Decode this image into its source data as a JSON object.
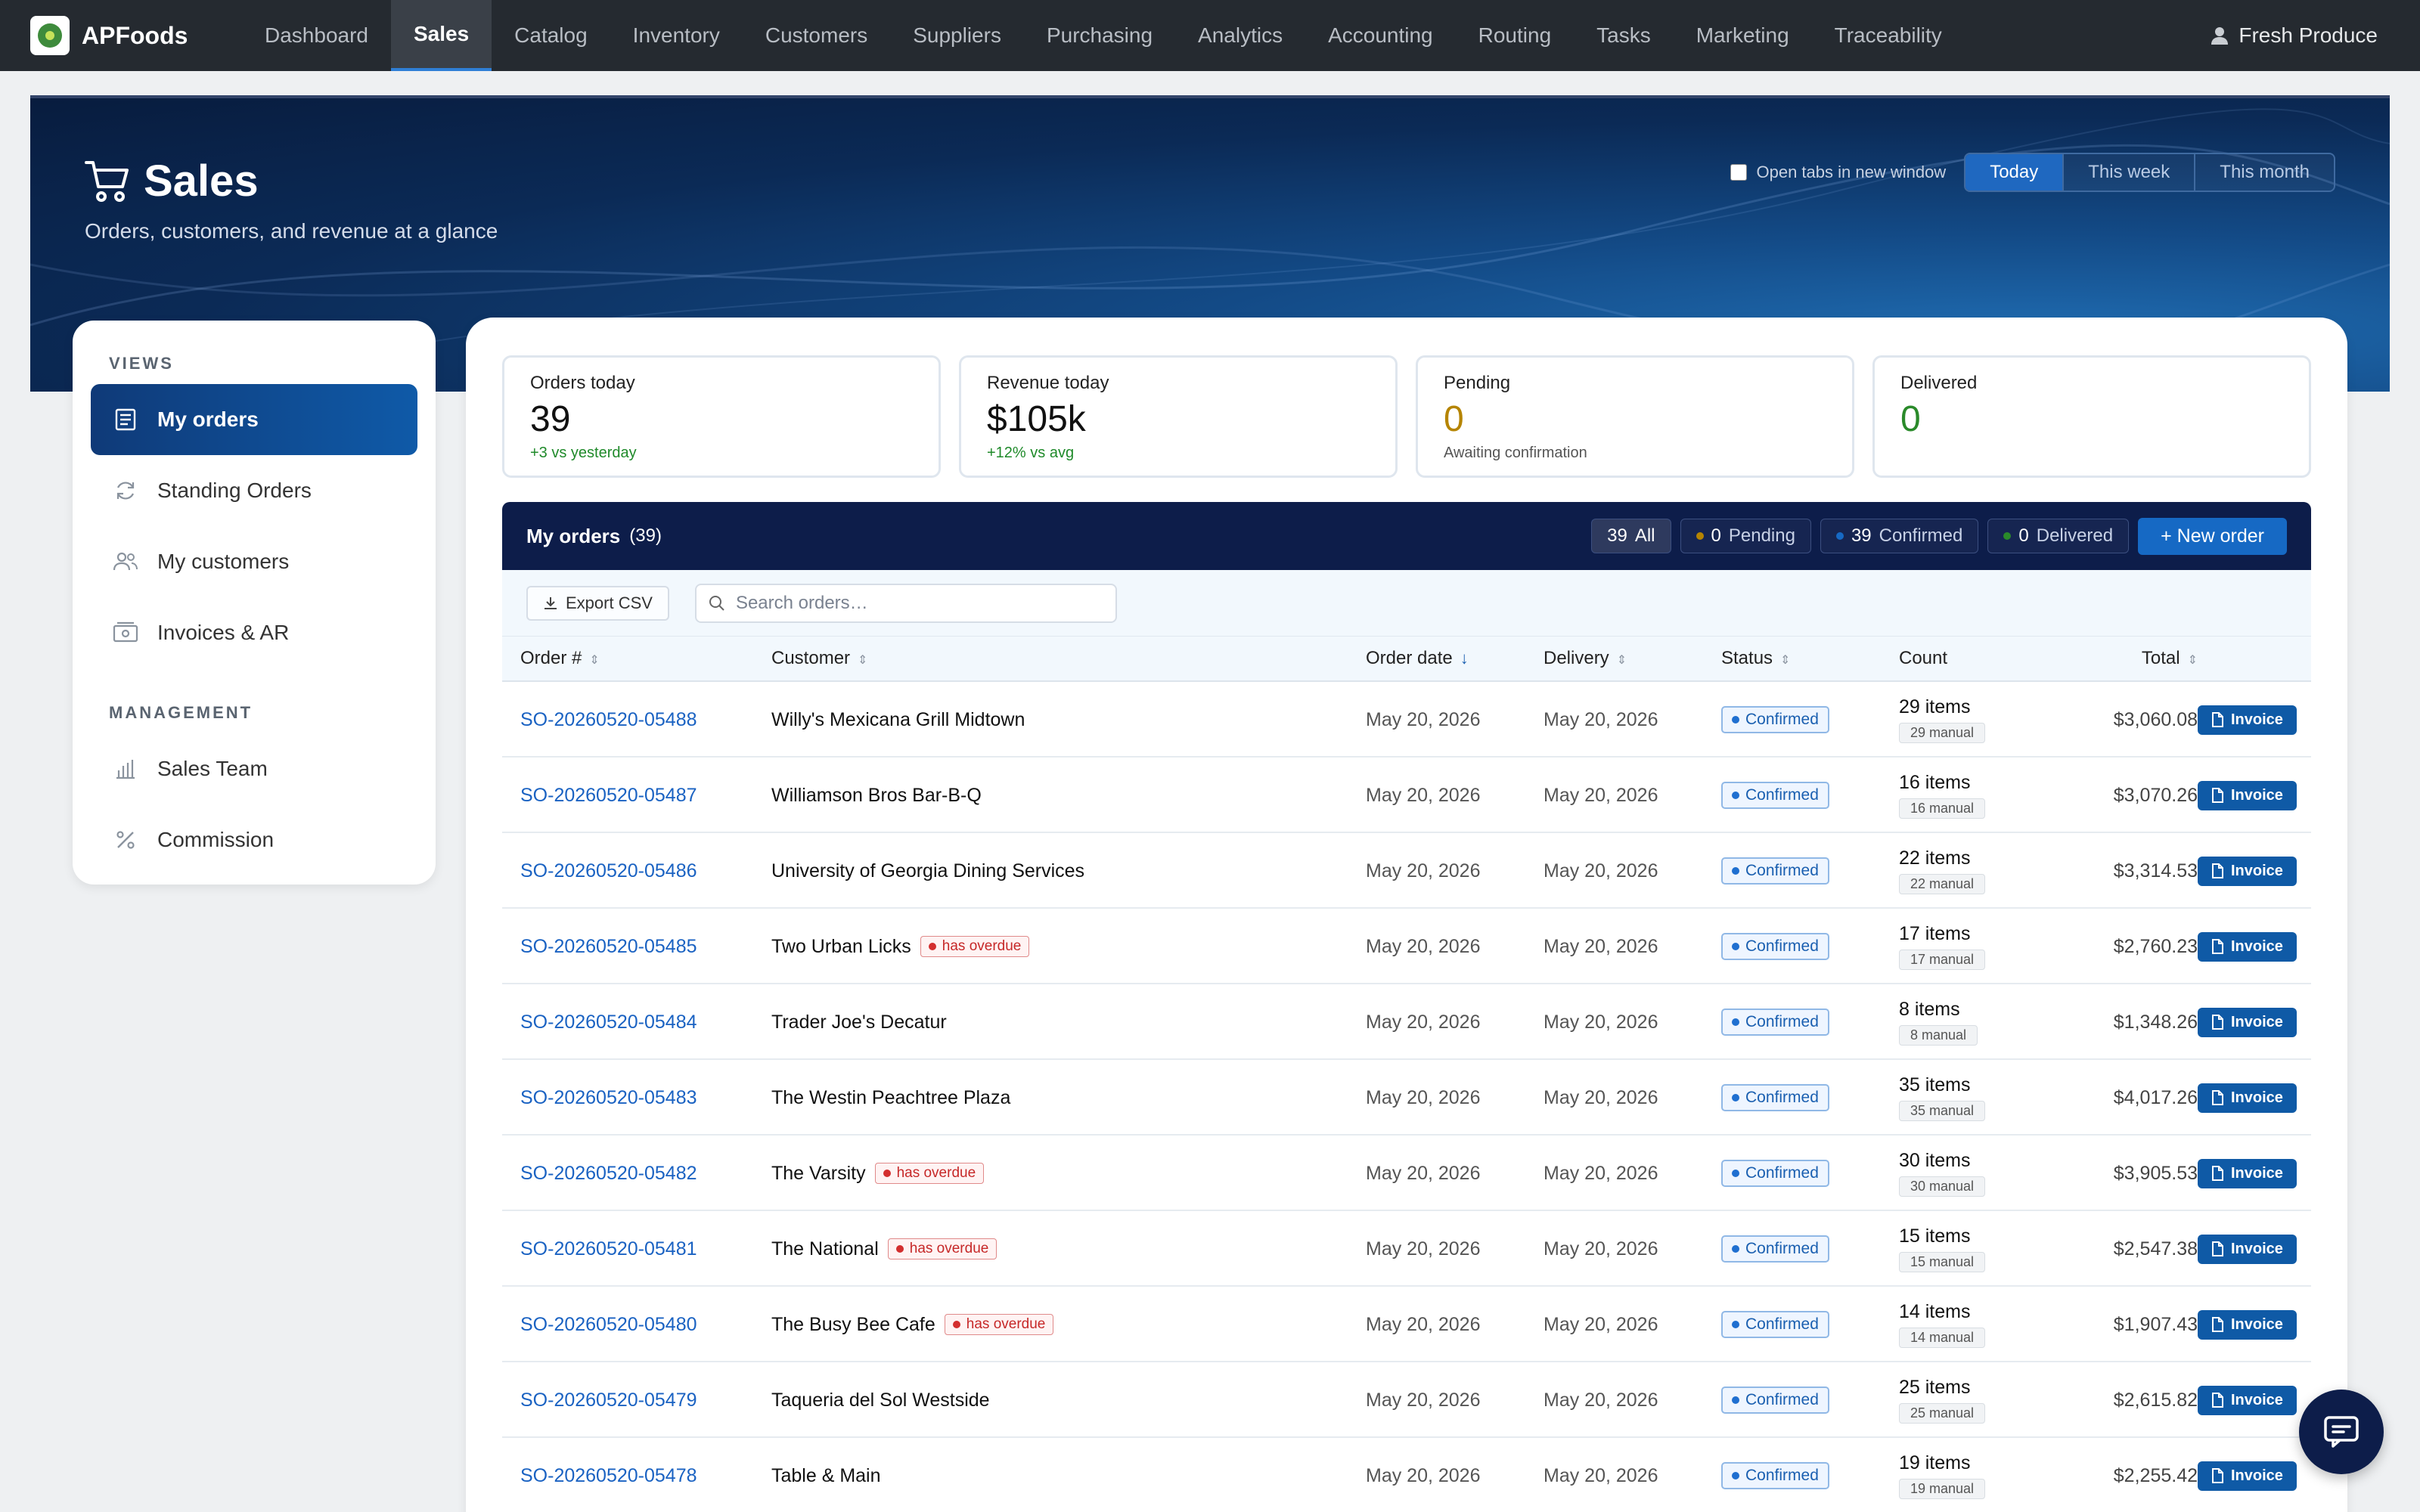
{
  "app": {
    "name": "APFoods",
    "user": "Fresh Produce"
  },
  "nav": [
    {
      "label": "Dashboard"
    },
    {
      "label": "Sales",
      "active": true
    },
    {
      "label": "Catalog"
    },
    {
      "label": "Inventory"
    },
    {
      "label": "Customers"
    },
    {
      "label": "Suppliers"
    },
    {
      "label": "Purchasing"
    },
    {
      "label": "Analytics"
    },
    {
      "label": "Accounting"
    },
    {
      "label": "Routing"
    },
    {
      "label": "Tasks"
    },
    {
      "label": "Marketing"
    },
    {
      "label": "Traceability"
    }
  ],
  "hero": {
    "title": "Sales",
    "subtitle": "Orders, customers, and revenue at a glance",
    "open_tabs_label": "Open tabs in new window",
    "ranges": [
      "Today",
      "This week",
      "This month"
    ],
    "active_range": "Today"
  },
  "sidebar": {
    "views_heading": "VIEWS",
    "views": [
      {
        "label": "My orders",
        "icon": "orders-list-icon"
      },
      {
        "label": "Standing Orders",
        "icon": "refresh-icon"
      },
      {
        "label": "My customers",
        "icon": "users-icon"
      },
      {
        "label": "Invoices & AR",
        "icon": "cash-icon"
      }
    ],
    "management_heading": "MANAGEMENT",
    "management": [
      {
        "label": "Sales Team",
        "icon": "bar-chart-icon"
      },
      {
        "label": "Commission",
        "icon": "percent-icon"
      }
    ]
  },
  "stats": [
    {
      "label": "Orders today",
      "value": "39",
      "sub": "+3 vs yesterday"
    },
    {
      "label": "Revenue today",
      "value": "$105k",
      "sub": "+12% vs avg"
    },
    {
      "label": "Pending",
      "value": "0",
      "sub": "Awaiting confirmation"
    },
    {
      "label": "Delivered",
      "value": "0",
      "sub": ""
    }
  ],
  "orders": {
    "title": "My orders",
    "count": "(39)",
    "filters": [
      {
        "count": "39",
        "label": "All"
      },
      {
        "count": "0",
        "label": "Pending"
      },
      {
        "count": "39",
        "label": "Confirmed"
      },
      {
        "count": "0",
        "label": "Delivered"
      }
    ],
    "new_order_label": "+ New order",
    "export_label": "Export CSV",
    "search_placeholder": "Search orders…",
    "columns": [
      "Order #",
      "Customer",
      "Order date",
      "Delivery",
      "Status",
      "Count",
      "Total"
    ],
    "invoice_label": "Invoice",
    "overdue_label": "has overdue",
    "rows": [
      {
        "order": "SO-20260520-05488",
        "customer": "Willy's Mexicana Grill Midtown",
        "overdue": false,
        "order_date": "May 20, 2026",
        "delivery": "May 20, 2026",
        "status": "Confirmed",
        "items": "29 items",
        "manual": "29 manual",
        "total": "$3,060.08"
      },
      {
        "order": "SO-20260520-05487",
        "customer": "Williamson Bros Bar-B-Q",
        "overdue": false,
        "order_date": "May 20, 2026",
        "delivery": "May 20, 2026",
        "status": "Confirmed",
        "items": "16 items",
        "manual": "16 manual",
        "total": "$3,070.26"
      },
      {
        "order": "SO-20260520-05486",
        "customer": "University of Georgia Dining Services",
        "overdue": false,
        "order_date": "May 20, 2026",
        "delivery": "May 20, 2026",
        "status": "Confirmed",
        "items": "22 items",
        "manual": "22 manual",
        "total": "$3,314.53"
      },
      {
        "order": "SO-20260520-05485",
        "customer": "Two Urban Licks",
        "overdue": true,
        "order_date": "May 20, 2026",
        "delivery": "May 20, 2026",
        "status": "Confirmed",
        "items": "17 items",
        "manual": "17 manual",
        "total": "$2,760.23"
      },
      {
        "order": "SO-20260520-05484",
        "customer": "Trader Joe's Decatur",
        "overdue": false,
        "order_date": "May 20, 2026",
        "delivery": "May 20, 2026",
        "status": "Confirmed",
        "items": "8 items",
        "manual": "8 manual",
        "total": "$1,348.26"
      },
      {
        "order": "SO-20260520-05483",
        "customer": "The Westin Peachtree Plaza",
        "overdue": false,
        "order_date": "May 20, 2026",
        "delivery": "May 20, 2026",
        "status": "Confirmed",
        "items": "35 items",
        "manual": "35 manual",
        "total": "$4,017.26"
      },
      {
        "order": "SO-20260520-05482",
        "customer": "The Varsity",
        "overdue": true,
        "order_date": "May 20, 2026",
        "delivery": "May 20, 2026",
        "status": "Confirmed",
        "items": "30 items",
        "manual": "30 manual",
        "total": "$3,905.53"
      },
      {
        "order": "SO-20260520-05481",
        "customer": "The National",
        "overdue": true,
        "order_date": "May 20, 2026",
        "delivery": "May 20, 2026",
        "status": "Confirmed",
        "items": "15 items",
        "manual": "15 manual",
        "total": "$2,547.38"
      },
      {
        "order": "SO-20260520-05480",
        "customer": "The Busy Bee Cafe",
        "overdue": true,
        "order_date": "May 20, 2026",
        "delivery": "May 20, 2026",
        "status": "Confirmed",
        "items": "14 items",
        "manual": "14 manual",
        "total": "$1,907.43"
      },
      {
        "order": "SO-20260520-05479",
        "customer": "Taqueria del Sol Westside",
        "overdue": false,
        "order_date": "May 20, 2026",
        "delivery": "May 20, 2026",
        "status": "Confirmed",
        "items": "25 items",
        "manual": "25 manual",
        "total": "$2,615.82"
      },
      {
        "order": "SO-20260520-05478",
        "customer": "Table & Main",
        "overdue": false,
        "order_date": "May 20, 2026",
        "delivery": "May 20, 2026",
        "status": "Confirmed",
        "items": "19 items",
        "manual": "19 manual",
        "total": "$2,255.42"
      }
    ]
  },
  "colors": {
    "accent": "#1669c4",
    "nav_bg": "#252a30",
    "table_header": "#0d1d4a",
    "overdue": "#d32f2f",
    "pending_dot": "#b58400",
    "delivered_dot": "#2a8a2a"
  }
}
